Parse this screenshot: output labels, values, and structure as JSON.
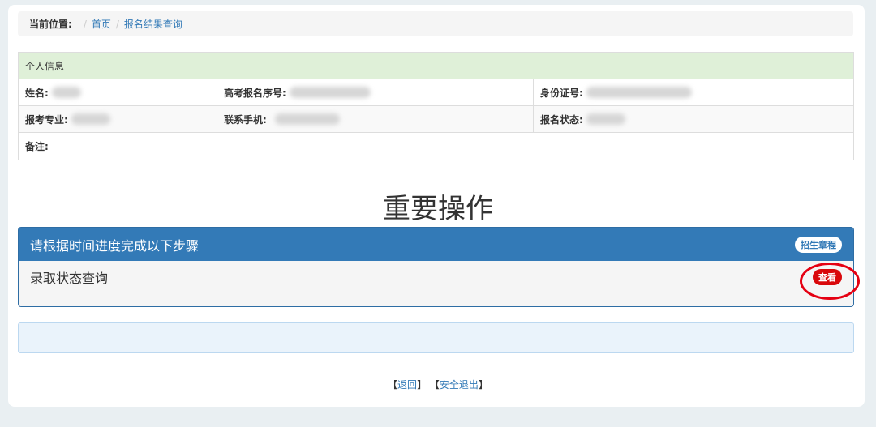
{
  "breadcrumb": {
    "label": "当前位置:",
    "home": "首页",
    "current": "报名结果查询"
  },
  "info": {
    "header": "个人信息",
    "name_label": "姓名:",
    "exam_no_label": "高考报名序号:",
    "id_label": "身份证号:",
    "major_label": "报考专业:",
    "phone_label": "联系手机:",
    "status_label": "报名状态:",
    "remark_label": "备注:"
  },
  "section_title": "重要操作",
  "panel": {
    "heading": "请根据时间进度完成以下步骤",
    "heading_badge": "招生章程",
    "item_label": "录取状态查询",
    "item_badge": "查看"
  },
  "footer": {
    "back_open": "【",
    "back": "返回",
    "back_close": "】",
    "logout_open": "【",
    "logout": "安全退出",
    "logout_close": "】"
  },
  "colors": {
    "primary": "#337ab7",
    "success_bg": "#dff0d8",
    "danger": "#d9080b",
    "annotation": "#e50012"
  }
}
